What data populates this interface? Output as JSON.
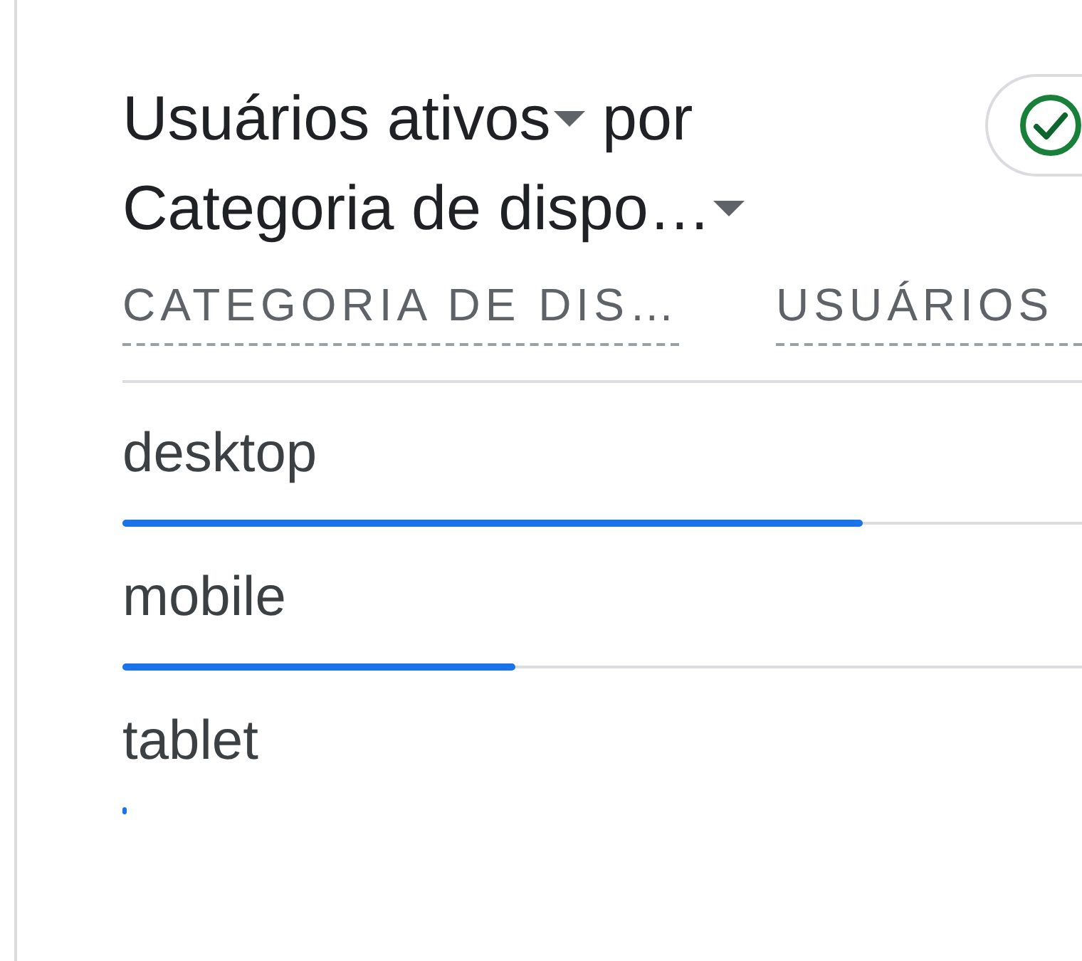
{
  "card": {
    "title": {
      "metric": "Usuários ativos",
      "connector": "por",
      "dimension": "Categoria de dispo…"
    },
    "table": {
      "columns": [
        "CATEGORIA DE DIS…",
        "USUÁRIOS"
      ],
      "rows": [
        {
          "label": "desktop",
          "level": 0.772
        },
        {
          "label": "mobile",
          "level": 0.41
        },
        {
          "label": "tablet",
          "level": 0.005
        }
      ]
    }
  }
}
